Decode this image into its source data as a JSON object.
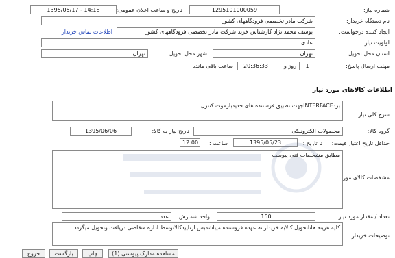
{
  "header": {
    "need_number_label": "شماره نیاز:",
    "need_number": "1295101000059",
    "announce_label": "تاریخ و ساعت اعلان عمومی:",
    "announce_value": "1395/05/17 - 14:18",
    "buyer_org_label": "نام دستگاه خریدار:",
    "buyer_org": "شرکت مادر تخصصی فرودگاههای کشور",
    "creator_label": "ایجاد کننده درخواست:",
    "creator": "یوسف  محمد نژاد کارشناس خرید  شرکت مادر تخصصی فرودگاههای کشور",
    "contact_link": "اطلاعات تماس خریدار",
    "priority_label": "اولویت نیاز :",
    "priority": "عادی",
    "province_label": "استان محل تحویل:",
    "province": "تهران",
    "city_label": "شهر محل تحویل:",
    "city": "تهران",
    "deadline_label": "مهلت ارسال پاسخ:",
    "deadline_days": "1",
    "days_word": "روز و",
    "deadline_time": "20:36:33",
    "remaining_label": "ساعت باقی مانده"
  },
  "section": {
    "title": "اطلاعات کالاهای مورد نیاز"
  },
  "goods": {
    "description_label": "شرح کلی نیاز:",
    "description": "بردINTERFACEجهت تطبیق فرستنده های جدیدبارموت کنترل",
    "group_label": "گروه کالا:",
    "group": "محصولات الکترونیکی",
    "need_date_label": "تاریخ نیاز به کالا:",
    "need_date": "1395/06/06",
    "min_validity_label": "حداقل تاریخ اعتبار قیمت:",
    "until_date_label": "تا تاریخ :",
    "until_date": "1395/05/23",
    "time_label": "ساعت :",
    "time": "12:00",
    "specs_label": "مشخصات کالای مورد نیاز:",
    "specs": "مطابق مشخصات فنی پیوست",
    "qty_label": "تعداد / مقدار مورد نیاز:",
    "qty": "150",
    "unit_label": "واحد شمارش:",
    "unit": "عدد",
    "buyer_notes_label": "توضیحات خریدار:",
    "buyer_notes": "کلیه هزینه هاتاتحویل کالابه خریدارانه عهده فروشنده میباشدبس ازتاییدکالاتوسط اداره متقاضی دریافت وتحویل میگردد"
  },
  "buttons": {
    "view_docs": "مشاهده مدارک پیوستی (1)",
    "print": "چاپ",
    "back": "بازگشت",
    "exit": "خروج"
  }
}
